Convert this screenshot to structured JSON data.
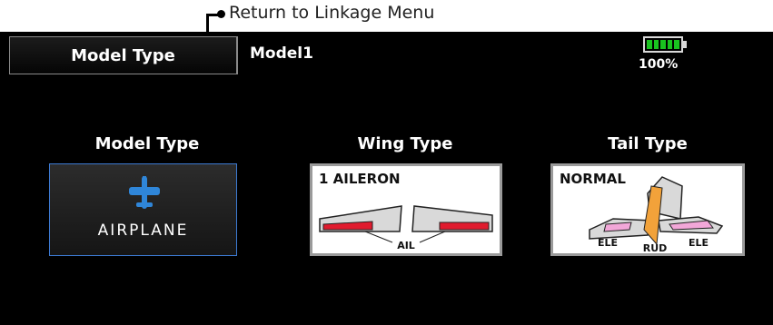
{
  "annotation": {
    "text": "Return to Linkage Menu"
  },
  "header": {
    "title": "Model Type",
    "model_name": "Model1",
    "battery_label": "100%",
    "battery_level": 1.0
  },
  "sections": {
    "model_type": {
      "heading": "Model Type",
      "label": "AIRPLANE"
    },
    "wing_type": {
      "heading": "Wing Type",
      "label": "1 AILERON",
      "callout": "AIL"
    },
    "tail_type": {
      "heading": "Tail Type",
      "label": "NORMAL",
      "callouts": [
        "ELE",
        "RUD",
        "ELE"
      ]
    }
  },
  "colors": {
    "accent_border": "#3c7ad2",
    "airplane_icon": "#2f86d9",
    "aileron": "#e01b2e",
    "elevator": "#f2a7d8",
    "rudder": "#f2a23a",
    "battery": "#19c31f"
  }
}
